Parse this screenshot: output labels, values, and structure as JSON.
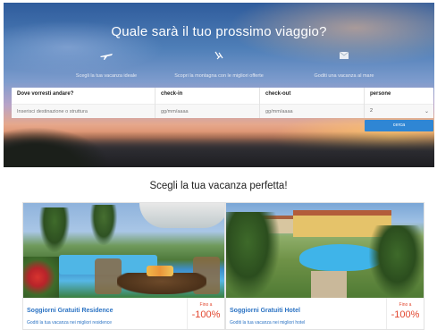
{
  "hero": {
    "title": "Quale sarà il tuo prossimo viaggio?",
    "features": [
      {
        "icon": "airplane-icon",
        "label": "Scegli la tua vacanza ideale"
      },
      {
        "icon": "mountain-icon",
        "label": "Scopri la montagna con le migliori offerte"
      },
      {
        "icon": "envelope-icon",
        "label": "Goditi una vacanza al mare"
      }
    ]
  },
  "search": {
    "destination": {
      "label": "Dove vorresti andare?",
      "placeholder": "Inserisci destinazione o struttura"
    },
    "checkin": {
      "label": "check-in",
      "placeholder": "gg/mm/aaaa"
    },
    "checkout": {
      "label": "check-out",
      "placeholder": "gg/mm/aaaa"
    },
    "persons": {
      "label": "persone",
      "value": "2"
    },
    "button_label": "cerca",
    "colors": {
      "button": "#2f86d4"
    }
  },
  "section": {
    "title": "Scegli la tua vacanza perfetta!"
  },
  "cards": [
    {
      "title": "Soggiorni Gratuiti Residence",
      "subtitle": "Goditi la tua vacanza nei migliori residence",
      "price_prefix": "Fino a",
      "discount": "-100%"
    },
    {
      "title": "Soggiorni Gratuiti Hotel",
      "subtitle": "Goditi la tua vacanza nei migliori hotel",
      "price_prefix": "Fino a",
      "discount": "-100%"
    }
  ],
  "colors": {
    "accent": "#2d74c4",
    "discount": "#e2472f"
  }
}
